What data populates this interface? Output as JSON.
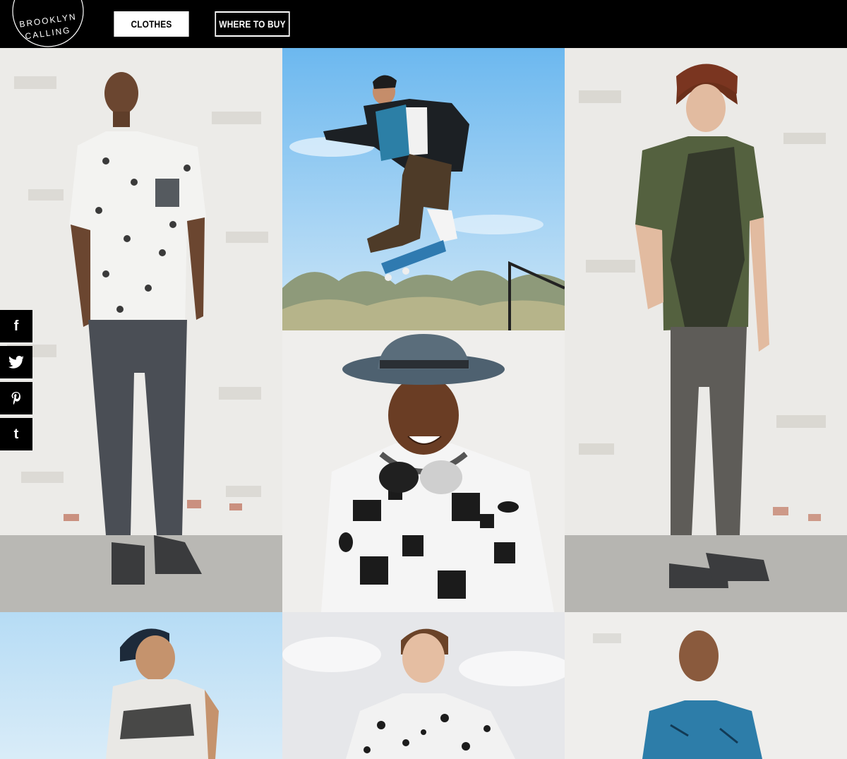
{
  "brand": {
    "line1": "BROOKLYN",
    "line2": "CALLING"
  },
  "nav": {
    "clothes_label": "CLOTHES",
    "where_label": "WHERE TO BUY"
  },
  "social": [
    {
      "icon": "facebook-icon",
      "glyph": "f"
    },
    {
      "icon": "twitter-icon",
      "glyph": ""
    },
    {
      "icon": "pinterest-icon",
      "glyph": ""
    },
    {
      "icon": "tumblr-icon",
      "glyph": "t"
    }
  ],
  "tiles": [
    {
      "name": "photo-model-white-print-tee"
    },
    {
      "name": "photo-skateboarder-jump"
    },
    {
      "name": "photo-model-green-tee"
    },
    {
      "name": "photo-model-comic-tee-hat"
    },
    {
      "name": "photo-model-nyc-tank"
    },
    {
      "name": "photo-model-splatter-shirt"
    },
    {
      "name": "photo-model-blue-tee"
    }
  ],
  "colors": {
    "header_bg": "#000000",
    "accent": "#ffffff"
  }
}
